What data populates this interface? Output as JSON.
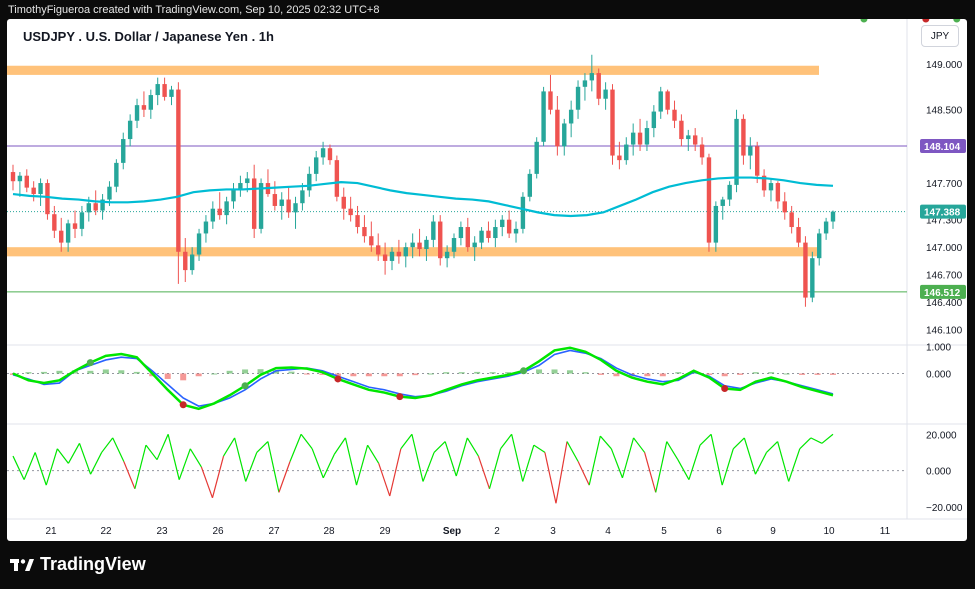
{
  "caption": "TimothyFigueroa created with TradingView.com, Sep 10, 2025 02:32 UTC+8",
  "symbol_title": "USDJPY . U.S. Dollar / Japanese Yen . 1h",
  "currency_button": "JPY",
  "brand": "TradingView",
  "colors": {
    "bull": "#26a69a",
    "bear": "#ef5350",
    "ma": "#00bcd4",
    "zone": "#ffc27a",
    "purple": "#7e57c2",
    "green_line": "#4caf50",
    "macd_blue": "#2962ff",
    "k_green": "#00e600",
    "k_red": "#e53935"
  },
  "chart_data": [
    {
      "type": "candlestick",
      "title": "USDJPY . U.S. Dollar / Japanese Yen . 1h",
      "x_ticks": [
        "21",
        "22",
        "23",
        "26",
        "27",
        "28",
        "29",
        "Sep",
        "2",
        "3",
        "4",
        "5",
        "6",
        "9",
        "10",
        "11"
      ],
      "y_ticks": [
        149.0,
        148.5,
        147.7,
        147.3,
        147.0,
        146.7,
        146.4,
        146.1
      ],
      "ylim": [
        146.02,
        149.25
      ],
      "price_labels": [
        {
          "text": "148.104",
          "value": 148.104,
          "color": "#7e57c2"
        },
        {
          "text": "147.388",
          "value": 147.388,
          "color": "#26a69a"
        },
        {
          "text": "146.512",
          "value": 146.512,
          "color": "#4caf50"
        }
      ],
      "zones": [
        {
          "low": 148.88,
          "high": 148.98
        },
        {
          "low": 146.9,
          "high": 147.0
        }
      ],
      "hlines": [
        {
          "value": 148.104,
          "color": "#7e57c2"
        },
        {
          "value": 146.512,
          "color": "#4caf50"
        }
      ],
      "current_price": 147.388,
      "ohlc": [
        [
          147.82,
          147.9,
          147.62,
          147.72
        ],
        [
          147.72,
          147.82,
          147.55,
          147.78
        ],
        [
          147.78,
          147.85,
          147.6,
          147.65
        ],
        [
          147.65,
          147.72,
          147.5,
          147.58
        ],
        [
          147.58,
          147.75,
          147.45,
          147.7
        ],
        [
          147.7,
          147.74,
          147.3,
          147.36
        ],
        [
          147.36,
          147.45,
          147.1,
          147.18
        ],
        [
          147.18,
          147.32,
          146.95,
          147.05
        ],
        [
          147.05,
          147.3,
          146.95,
          147.26
        ],
        [
          147.26,
          147.4,
          147.1,
          147.2
        ],
        [
          147.2,
          147.45,
          147.12,
          147.38
        ],
        [
          147.38,
          147.55,
          147.28,
          147.48
        ],
        [
          147.48,
          147.62,
          147.35,
          147.4
        ],
        [
          147.4,
          147.58,
          147.3,
          147.52
        ],
        [
          147.52,
          147.72,
          147.45,
          147.66
        ],
        [
          147.66,
          147.96,
          147.6,
          147.92
        ],
        [
          147.92,
          148.25,
          147.85,
          148.18
        ],
        [
          148.18,
          148.45,
          148.1,
          148.38
        ],
        [
          148.38,
          148.62,
          148.3,
          148.55
        ],
        [
          148.55,
          148.7,
          148.42,
          148.5
        ],
        [
          148.5,
          148.72,
          148.4,
          148.66
        ],
        [
          148.66,
          148.85,
          148.55,
          148.78
        ],
        [
          148.78,
          148.85,
          148.6,
          148.64
        ],
        [
          148.64,
          148.76,
          148.55,
          148.72
        ],
        [
          148.72,
          148.8,
          146.6,
          146.95
        ],
        [
          146.95,
          147.1,
          146.62,
          146.75
        ],
        [
          146.75,
          147.0,
          146.7,
          146.92
        ],
        [
          146.92,
          147.2,
          146.85,
          147.15
        ],
        [
          147.15,
          147.35,
          147.05,
          147.28
        ],
        [
          147.28,
          147.5,
          147.2,
          147.42
        ],
        [
          147.42,
          147.6,
          147.3,
          147.35
        ],
        [
          147.35,
          147.55,
          147.25,
          147.5
        ],
        [
          147.5,
          147.7,
          147.42,
          147.62
        ],
        [
          147.62,
          147.78,
          147.55,
          147.7
        ],
        [
          147.7,
          147.82,
          147.6,
          147.75
        ],
        [
          147.75,
          147.9,
          147.1,
          147.2
        ],
        [
          147.2,
          147.75,
          147.15,
          147.7
        ],
        [
          147.7,
          147.85,
          147.55,
          147.58
        ],
        [
          147.58,
          147.72,
          147.4,
          147.45
        ],
        [
          147.45,
          147.6,
          147.3,
          147.52
        ],
        [
          147.52,
          147.65,
          147.32,
          147.38
        ],
        [
          147.38,
          147.55,
          147.2,
          147.48
        ],
        [
          147.48,
          147.7,
          147.4,
          147.62
        ],
        [
          147.62,
          147.88,
          147.55,
          147.8
        ],
        [
          147.8,
          148.05,
          147.72,
          147.98
        ],
        [
          147.98,
          148.15,
          147.9,
          148.08
        ],
        [
          148.08,
          148.12,
          147.9,
          147.95
        ],
        [
          147.95,
          148.0,
          147.5,
          147.55
        ],
        [
          147.55,
          147.65,
          147.3,
          147.42
        ],
        [
          147.42,
          147.55,
          147.28,
          147.35
        ],
        [
          147.35,
          147.45,
          147.15,
          147.22
        ],
        [
          147.22,
          147.35,
          147.05,
          147.12
        ],
        [
          147.12,
          147.28,
          146.95,
          147.02
        ],
        [
          147.02,
          147.15,
          146.85,
          146.92
        ],
        [
          146.92,
          147.05,
          146.7,
          146.85
        ],
        [
          146.85,
          147.0,
          146.75,
          146.95
        ],
        [
          146.95,
          147.08,
          146.82,
          146.9
        ],
        [
          146.9,
          147.05,
          146.78,
          147.0
        ],
        [
          147.0,
          147.15,
          146.88,
          147.05
        ],
        [
          147.05,
          147.2,
          146.9,
          146.98
        ],
        [
          146.98,
          147.12,
          146.85,
          147.08
        ],
        [
          147.08,
          147.35,
          147.0,
          147.28
        ],
        [
          147.28,
          147.35,
          146.8,
          146.88
        ],
        [
          146.88,
          147.02,
          146.78,
          146.95
        ],
        [
          146.95,
          147.15,
          146.88,
          147.1
        ],
        [
          147.1,
          147.28,
          147.02,
          147.22
        ],
        [
          147.22,
          147.32,
          146.95,
          147.0
        ],
        [
          147.0,
          147.12,
          146.85,
          147.05
        ],
        [
          147.05,
          147.22,
          146.98,
          147.18
        ],
        [
          147.18,
          147.28,
          147.05,
          147.1
        ],
        [
          147.1,
          147.3,
          147.0,
          147.22
        ],
        [
          147.22,
          147.35,
          147.12,
          147.3
        ],
        [
          147.3,
          147.4,
          147.1,
          147.15
        ],
        [
          147.15,
          147.28,
          147.05,
          147.2
        ],
        [
          147.2,
          147.6,
          147.15,
          147.55
        ],
        [
          147.55,
          147.85,
          147.5,
          147.8
        ],
        [
          147.8,
          148.2,
          147.75,
          148.15
        ],
        [
          148.15,
          148.75,
          148.1,
          148.7
        ],
        [
          148.7,
          148.88,
          148.45,
          148.5
        ],
        [
          148.5,
          148.65,
          148.0,
          148.1
        ],
        [
          148.1,
          148.4,
          148.0,
          148.35
        ],
        [
          148.35,
          148.6,
          148.2,
          148.5
        ],
        [
          148.5,
          148.82,
          148.4,
          148.75
        ],
        [
          148.75,
          148.9,
          148.6,
          148.82
        ],
        [
          148.82,
          149.1,
          148.7,
          148.9
        ],
        [
          148.9,
          148.95,
          148.55,
          148.62
        ],
        [
          148.62,
          148.8,
          148.5,
          148.72
        ],
        [
          148.72,
          148.78,
          147.9,
          148.0
        ],
        [
          148.0,
          148.15,
          147.85,
          147.95
        ],
        [
          147.95,
          148.2,
          147.9,
          148.12
        ],
        [
          148.12,
          148.35,
          148.0,
          148.25
        ],
        [
          148.25,
          148.4,
          148.05,
          148.12
        ],
        [
          148.12,
          148.38,
          148.05,
          148.3
        ],
        [
          148.3,
          148.55,
          148.2,
          148.48
        ],
        [
          148.48,
          148.75,
          148.4,
          148.7
        ],
        [
          148.7,
          148.72,
          148.45,
          148.5
        ],
        [
          148.5,
          148.6,
          148.3,
          148.38
        ],
        [
          148.38,
          148.45,
          148.1,
          148.18
        ],
        [
          148.18,
          148.28,
          148.05,
          148.22
        ],
        [
          148.22,
          148.3,
          148.05,
          148.12
        ],
        [
          148.12,
          148.2,
          147.9,
          147.98
        ],
        [
          147.98,
          148.02,
          146.95,
          147.05
        ],
        [
          147.05,
          147.5,
          146.95,
          147.45
        ],
        [
          147.45,
          147.55,
          147.3,
          147.52
        ],
        [
          147.52,
          147.72,
          147.45,
          147.68
        ],
        [
          147.68,
          148.5,
          147.6,
          148.4
        ],
        [
          148.4,
          148.45,
          147.9,
          148.0
        ],
        [
          148.0,
          148.2,
          147.85,
          148.1
        ],
        [
          148.1,
          148.15,
          147.7,
          147.78
        ],
        [
          147.78,
          147.85,
          147.55,
          147.62
        ],
        [
          147.62,
          147.75,
          147.5,
          147.7
        ],
        [
          147.7,
          147.72,
          147.42,
          147.5
        ],
        [
          147.5,
          147.6,
          147.3,
          147.38
        ],
        [
          147.38,
          147.45,
          147.15,
          147.22
        ],
        [
          147.22,
          147.32,
          147.0,
          147.05
        ],
        [
          147.05,
          147.12,
          146.35,
          146.45
        ],
        [
          146.45,
          146.95,
          146.4,
          146.88
        ],
        [
          146.88,
          147.2,
          146.8,
          147.15
        ],
        [
          147.15,
          147.32,
          147.08,
          147.28
        ],
        [
          147.28,
          147.4,
          147.2,
          147.388
        ]
      ],
      "ma": [
        147.58,
        147.56,
        147.55,
        147.53,
        147.52,
        147.5,
        147.49,
        147.49,
        147.5,
        147.52,
        147.55,
        147.6,
        147.62,
        147.63,
        147.63,
        147.64,
        147.65,
        147.66,
        147.67,
        147.69,
        147.71,
        147.7,
        147.66,
        147.62,
        147.59,
        147.57,
        147.55,
        147.53,
        147.52,
        147.5,
        147.46,
        147.42,
        147.38,
        147.35,
        147.34,
        147.35,
        147.38,
        147.45,
        147.52,
        147.6,
        147.66,
        147.7,
        147.73,
        147.75,
        147.76,
        147.76,
        147.75,
        147.73,
        147.7,
        147.68,
        147.67
      ]
    },
    {
      "type": "line",
      "title": "",
      "y_ticks": [
        1.0,
        0.0
      ],
      "ylim": [
        -1.6,
        1.05
      ],
      "series": [
        {
          "color": "#2962ff",
          "values": [
            -0.05,
            -0.2,
            -0.4,
            -0.35,
            0.1,
            0.3,
            0.5,
            0.6,
            0.55,
            0.1,
            -0.4,
            -0.9,
            -1.2,
            -1.1,
            -0.9,
            -0.6,
            -0.2,
            0.1,
            0.15,
            0.2,
            0.1,
            -0.1,
            -0.3,
            -0.5,
            -0.6,
            -0.75,
            -0.85,
            -0.8,
            -0.65,
            -0.45,
            -0.3,
            -0.2,
            -0.1,
            0.05,
            0.3,
            0.7,
            0.85,
            0.75,
            0.55,
            0.2,
            -0.05,
            -0.2,
            -0.3,
            -0.25,
            0.05,
            -0.1,
            -0.45,
            -0.55,
            -0.35,
            -0.2,
            -0.3,
            -0.45,
            -0.6,
            -0.75
          ]
        },
        {
          "color": "#00e600",
          "values": [
            0.0,
            -0.25,
            -0.35,
            -0.25,
            0.1,
            0.4,
            0.65,
            0.72,
            0.6,
            0.0,
            -0.6,
            -1.15,
            -1.3,
            -1.1,
            -0.8,
            -0.45,
            -0.05,
            0.2,
            0.22,
            0.18,
            0.05,
            -0.2,
            -0.4,
            -0.6,
            -0.7,
            -0.85,
            -0.9,
            -0.8,
            -0.6,
            -0.4,
            -0.25,
            -0.15,
            -0.05,
            0.1,
            0.45,
            0.85,
            0.95,
            0.8,
            0.5,
            0.1,
            -0.15,
            -0.3,
            -0.4,
            -0.2,
            0.1,
            -0.15,
            -0.55,
            -0.6,
            -0.3,
            -0.15,
            -0.3,
            -0.5,
            -0.65,
            -0.8
          ]
        }
      ],
      "histogram": [
        -0.05,
        0.05,
        0.06,
        0.1,
        0.12,
        0.1,
        0.15,
        0.12,
        0.06,
        -0.1,
        -0.2,
        -0.25,
        -0.1,
        0.0,
        0.1,
        0.15,
        0.16,
        0.12,
        0.07,
        -0.02,
        -0.05,
        -0.1,
        -0.1,
        -0.1,
        -0.1,
        -0.1,
        -0.06,
        0.0,
        0.05,
        0.05,
        0.06,
        0.05,
        0.05,
        0.05,
        0.15,
        0.15,
        0.12,
        0.05,
        -0.05,
        -0.1,
        -0.1,
        -0.1,
        -0.1,
        0.05,
        0.05,
        -0.05,
        -0.1,
        -0.05,
        0.05,
        0.05,
        0.0,
        -0.05,
        -0.05,
        -0.05
      ],
      "markers": [
        {
          "i": 5,
          "color": "#4caf50"
        },
        {
          "i": 11,
          "color": "#c62828"
        },
        {
          "i": 15,
          "color": "#4caf50"
        },
        {
          "i": 21,
          "color": "#c62828"
        },
        {
          "i": 25,
          "color": "#c62828"
        },
        {
          "i": 33,
          "color": "#4caf50"
        },
        {
          "i": 46,
          "color": "#c62828"
        },
        {
          "i": 55,
          "color": "#4caf50"
        },
        {
          "i": 59,
          "color": "#c62828"
        },
        {
          "i": 61,
          "color": "#4caf50"
        },
        {
          "i": 65,
          "color": "#c62828"
        }
      ]
    },
    {
      "type": "line",
      "title": "",
      "y_ticks": [
        20.0,
        0.0,
        -20.0
      ],
      "ylim": [
        -25,
        24
      ],
      "series": [
        {
          "color": "#00e600",
          "values": [
            8,
            -5,
            10,
            -8,
            12,
            4,
            15,
            -2,
            10,
            18,
            5,
            -10,
            14,
            6,
            20,
            -5,
            12,
            2,
            -15,
            8,
            18,
            -6,
            10,
            16,
            -12,
            5,
            20,
            12,
            -4,
            9,
            18,
            -8,
            14,
            4,
            -14,
            12,
            20,
            -6,
            10,
            16,
            -3,
            18,
            8,
            -10,
            12,
            20,
            -6,
            14,
            10,
            -18,
            16,
            5,
            -8,
            19,
            12,
            -4,
            18,
            10,
            -12,
            16,
            6,
            -5,
            14,
            20,
            -8,
            12,
            18,
            -2,
            10,
            16,
            -6,
            12,
            18,
            15,
            20
          ]
        }
      ]
    }
  ]
}
